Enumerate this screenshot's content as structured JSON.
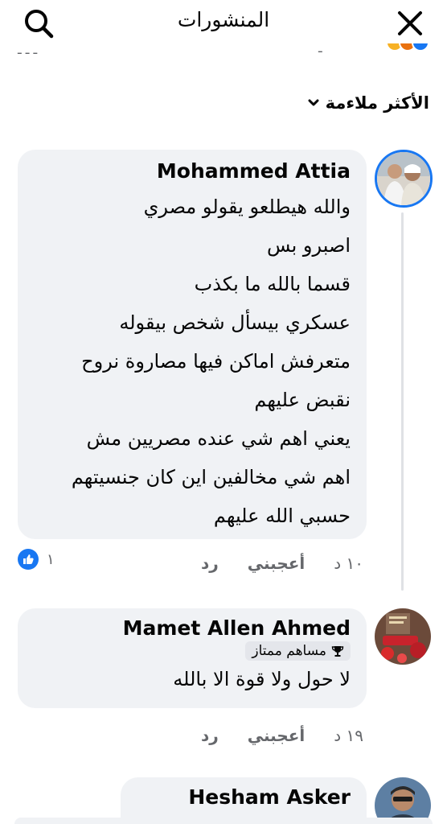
{
  "header": {
    "title": "المنشورات",
    "search_icon": "search-icon",
    "close_icon": "close-icon"
  },
  "sort": {
    "label": "الأكثر ملاءمة"
  },
  "comments": [
    {
      "author": "Mohammed Attia",
      "lines": [
        "والله هيطلعو يقولو مصري",
        "اصبرو بس",
        "قسما بالله ما بكذب",
        "عسكري بيسأل شخص بيقوله",
        "متعرفش اماكن فيها مصاروة نروح",
        "نقبض عليهم",
        "يعني اهم شي عنده مصريين مش",
        "اهم شي مخالفين اين كان جنسيتهم",
        "حسبي الله عليهم"
      ],
      "time": "١٠ د",
      "like_label": "أعجبني",
      "reply_label": "رد",
      "reaction_count": "١"
    },
    {
      "author": "Mamet Allen Ahmed",
      "badge": "مساهم ممتاز",
      "lines": [
        "لا حول ولا قوة الا بالله"
      ],
      "time": "١٩ د",
      "like_label": "أعجبني",
      "reply_label": "رد"
    },
    {
      "author": "Hesham Asker"
    }
  ],
  "colors": {
    "accent": "#1877f2",
    "bubble": "#f0f2f5",
    "secondary_text": "#65676b"
  }
}
